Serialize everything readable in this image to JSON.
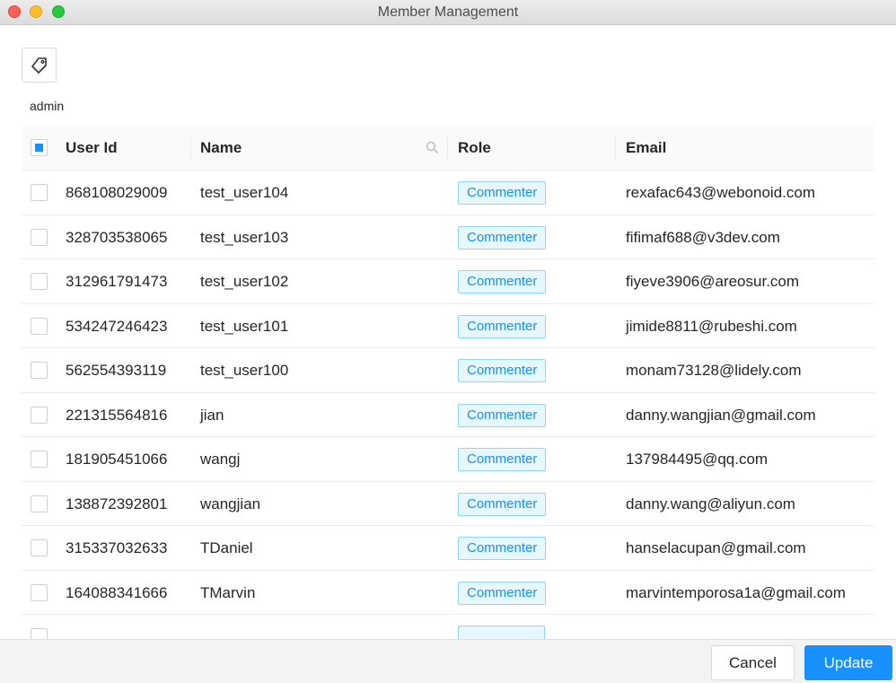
{
  "window": {
    "title": "Member Management"
  },
  "group": {
    "label": "admin"
  },
  "table": {
    "columns": [
      "User Id",
      "Name",
      "Role",
      "Email"
    ],
    "rows": [
      {
        "user_id": "868108029009",
        "name": "test_user104",
        "role": "Commenter",
        "email": "rexafac643@webonoid.com"
      },
      {
        "user_id": "328703538065",
        "name": "test_user103",
        "role": "Commenter",
        "email": "fifimaf688@v3dev.com"
      },
      {
        "user_id": "312961791473",
        "name": "test_user102",
        "role": "Commenter",
        "email": "fiyeve3906@areosur.com"
      },
      {
        "user_id": "534247246423",
        "name": "test_user101",
        "role": "Commenter",
        "email": "jimide8811@rubeshi.com"
      },
      {
        "user_id": "562554393119",
        "name": "test_user100",
        "role": "Commenter",
        "email": "monam73128@lidely.com"
      },
      {
        "user_id": "221315564816",
        "name": "jian",
        "role": "Commenter",
        "email": "danny.wangjian@gmail.com"
      },
      {
        "user_id": "181905451066",
        "name": "wangj",
        "role": "Commenter",
        "email": "137984495@qq.com"
      },
      {
        "user_id": "138872392801",
        "name": "wangjian",
        "role": "Commenter",
        "email": "danny.wang@aliyun.com"
      },
      {
        "user_id": "315337032633",
        "name": "TDaniel",
        "role": "Commenter",
        "email": "hanselacupan@gmail.com"
      },
      {
        "user_id": "164088341666",
        "name": "TMarvin",
        "role": "Commenter",
        "email": "marvintemporosa1a@gmail.com"
      }
    ]
  },
  "footer": {
    "cancel_label": "Cancel",
    "update_label": "Update"
  },
  "colors": {
    "accent": "#1890ff",
    "badge_bg": "#e6f7ff",
    "badge_border": "#91d5ff"
  },
  "icons": {
    "tag": "tag-icon",
    "search": "search-icon"
  }
}
